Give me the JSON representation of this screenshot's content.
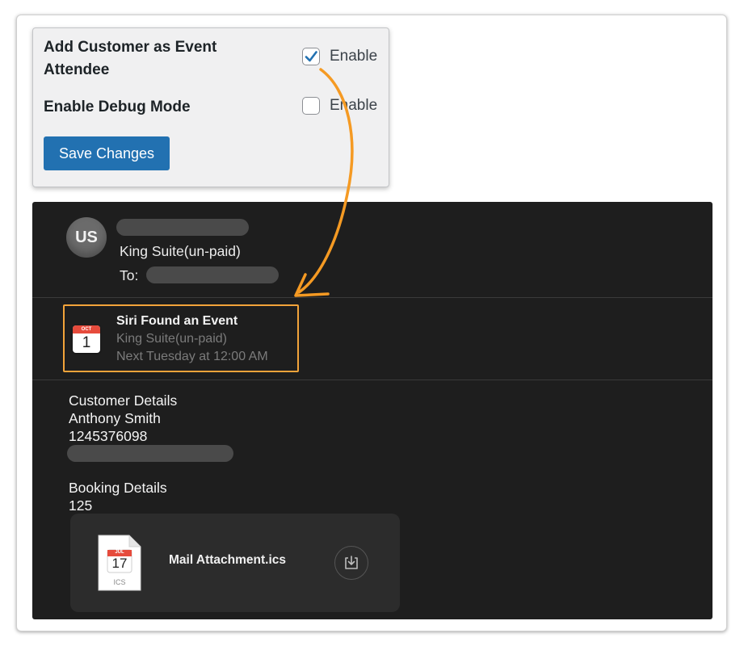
{
  "settings": {
    "attendee_label": "Add Customer as Event Attendee",
    "attendee_checked": true,
    "attendee_control_label": "Enable",
    "debug_label": "Enable Debug Mode",
    "debug_checked": false,
    "debug_control_label": "Enable",
    "save_label": "Save Changes"
  },
  "mail": {
    "avatar_initials": "US",
    "sender_name": "King Suite(un-paid)",
    "to_label": "To:",
    "siri_event": {
      "title": "Siri Found an Event",
      "calendar_month": "OCT",
      "calendar_day": "1",
      "subtitle": "King Suite(un-paid)",
      "when": "Next Tuesday at 12:00 AM"
    },
    "customer_heading": "Customer Details",
    "customer_name": "Anthony Smith",
    "customer_phone": "1245376098",
    "booking_heading": "Booking Details",
    "booking_id": "125",
    "attachment": {
      "month": "JUL",
      "day": "17",
      "file_type": "ICS",
      "file_name": "Mail Attachment.ics"
    }
  },
  "colors": {
    "primary_button": "#2271b1",
    "highlight_orange": "#f2a33a",
    "mail_background": "#1e1e1e"
  },
  "icons": [
    "checkmark-icon",
    "calendar-icon",
    "ics-file-icon",
    "download-icon",
    "annotation-arrow"
  ]
}
